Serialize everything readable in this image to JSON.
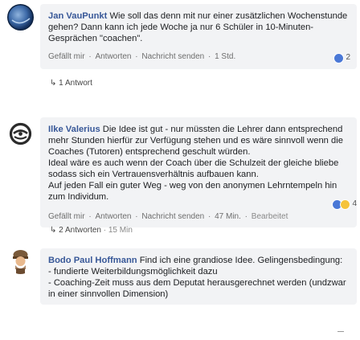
{
  "comments": [
    {
      "author": "Jan VauPunkt",
      "text": "Wie soll das denn mit nur einer zusätzlichen Wochenstunde gehen? Dann kann ich jede Woche ja nur 6 Schüler in 10-Minuten-Gesprächen \"coachen\".",
      "actions": [
        "Gefällt mir",
        "Antworten",
        "Nachricht senden"
      ],
      "time": "1 Std.",
      "reaction_count": "2",
      "replies_label": "1 Antwort"
    },
    {
      "author": "Ilke Valerius",
      "paragraphs": [
        "Die Idee ist gut - nur müssten die Lehrer dann entsprechend mehr Stunden hierfür zur Verfügung stehen und es wäre sinnvoll wenn die Coaches (Tutoren) entsprechend geschult würden.",
        "Ideal wäre es auch wenn der Coach über die Schulzeit der gleiche bliebe sodass sich ein Vertrauensverhältnis aufbauen kann.",
        "Auf jeden Fall ein guter Weg - weg von den anonymen Lehrntempeln hin zum Individum."
      ],
      "actions": [
        "Gefällt mir",
        "Antworten",
        "Nachricht senden"
      ],
      "time": "47 Min.",
      "edited": "Bearbeitet",
      "reaction_count": "4",
      "replies_label": "2 Antworten",
      "replies_time": "15 Min"
    },
    {
      "author": "Bodo Paul Hoffmann",
      "paragraphs": [
        "Find ich eine grandiose Idee. Gelingensbedingung:",
        "- fundierte Weiterbildungsmöglichkeit dazu",
        "- Coaching-Zeit muss aus dem Deputat herausgerechnet werden (undzwar in einer sinnvollen Dimension)"
      ]
    }
  ],
  "colors": {
    "author": "#385898",
    "bubble": "#f2f3f5",
    "like": "#4a78d6",
    "haha": "#f5c33b"
  },
  "icons": {
    "reply_arrow": "reply-arrow-icon",
    "like": "like-reaction-icon",
    "haha": "haha-reaction-icon"
  }
}
